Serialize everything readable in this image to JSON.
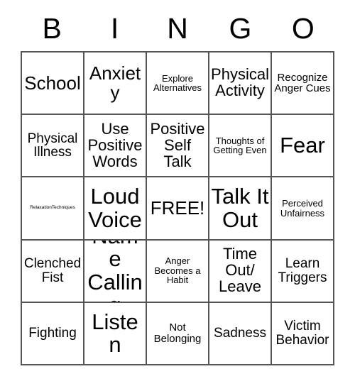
{
  "card": {
    "header_letters": [
      "B",
      "I",
      "N",
      "G",
      "O"
    ],
    "rows": [
      [
        {
          "text": "School",
          "size": "t-xl"
        },
        {
          "text": "Anxiety",
          "size": "t-xl"
        },
        {
          "text": "Explore Alternatives",
          "size": "t-xs"
        },
        {
          "text": "Physical Activity",
          "size": "t-lg"
        },
        {
          "text": "Recognize Anger Cues",
          "size": "t-sm"
        }
      ],
      [
        {
          "text": "Physical Illness",
          "size": "t-md"
        },
        {
          "text": "Use Positive Words",
          "size": "t-lg"
        },
        {
          "text": "Positive Self Talk",
          "size": "t-lg"
        },
        {
          "text": "Thoughts of Getting Even",
          "size": "t-xs"
        },
        {
          "text": "Fear",
          "size": "t-xxl"
        }
      ],
      [
        {
          "text": "RelaxationTechniques",
          "size": "t-tiny"
        },
        {
          "text": "Loud Voice",
          "size": "t-xxl"
        },
        {
          "text": "FREE!",
          "size": "t-xl"
        },
        {
          "text": "Talk It Out",
          "size": "t-xxl"
        },
        {
          "text": "Perceived Unfairness",
          "size": "t-xs"
        }
      ],
      [
        {
          "text": "Clenched Fist",
          "size": "t-md"
        },
        {
          "text": "Name Calling",
          "size": "t-xxl"
        },
        {
          "text": "Anger Becomes a Habit",
          "size": "t-xs"
        },
        {
          "text": "Time Out/ Leave",
          "size": "t-lg"
        },
        {
          "text": "Learn Triggers",
          "size": "t-md"
        }
      ],
      [
        {
          "text": "Fighting",
          "size": "t-md"
        },
        {
          "text": "Listen",
          "size": "t-xxl"
        },
        {
          "text": "Not Belonging",
          "size": "t-sm"
        },
        {
          "text": "Sadness",
          "size": "t-md"
        },
        {
          "text": "Victim Behavior",
          "size": "t-md"
        }
      ]
    ]
  },
  "colors": {
    "background": "#ffffff",
    "text": "#000000",
    "grid_line": "#555555"
  }
}
